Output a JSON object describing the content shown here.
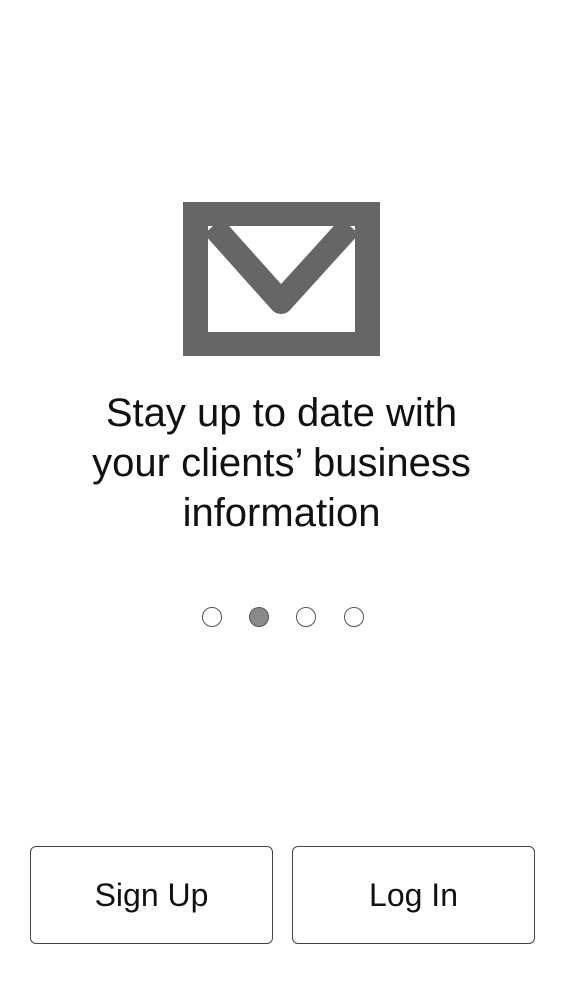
{
  "onboarding": {
    "icon": "envelope-icon",
    "headline_line1": "Stay up to date with",
    "headline_line2": "your clients’ business",
    "headline_line3": "information",
    "pager": {
      "total": 4,
      "active_index": 1
    }
  },
  "actions": {
    "signup_label": "Sign Up",
    "login_label": "Log In"
  },
  "colors": {
    "icon": "#666666",
    "text": "#111111",
    "active_dot": "#8a8a8a",
    "border": "#444444"
  }
}
